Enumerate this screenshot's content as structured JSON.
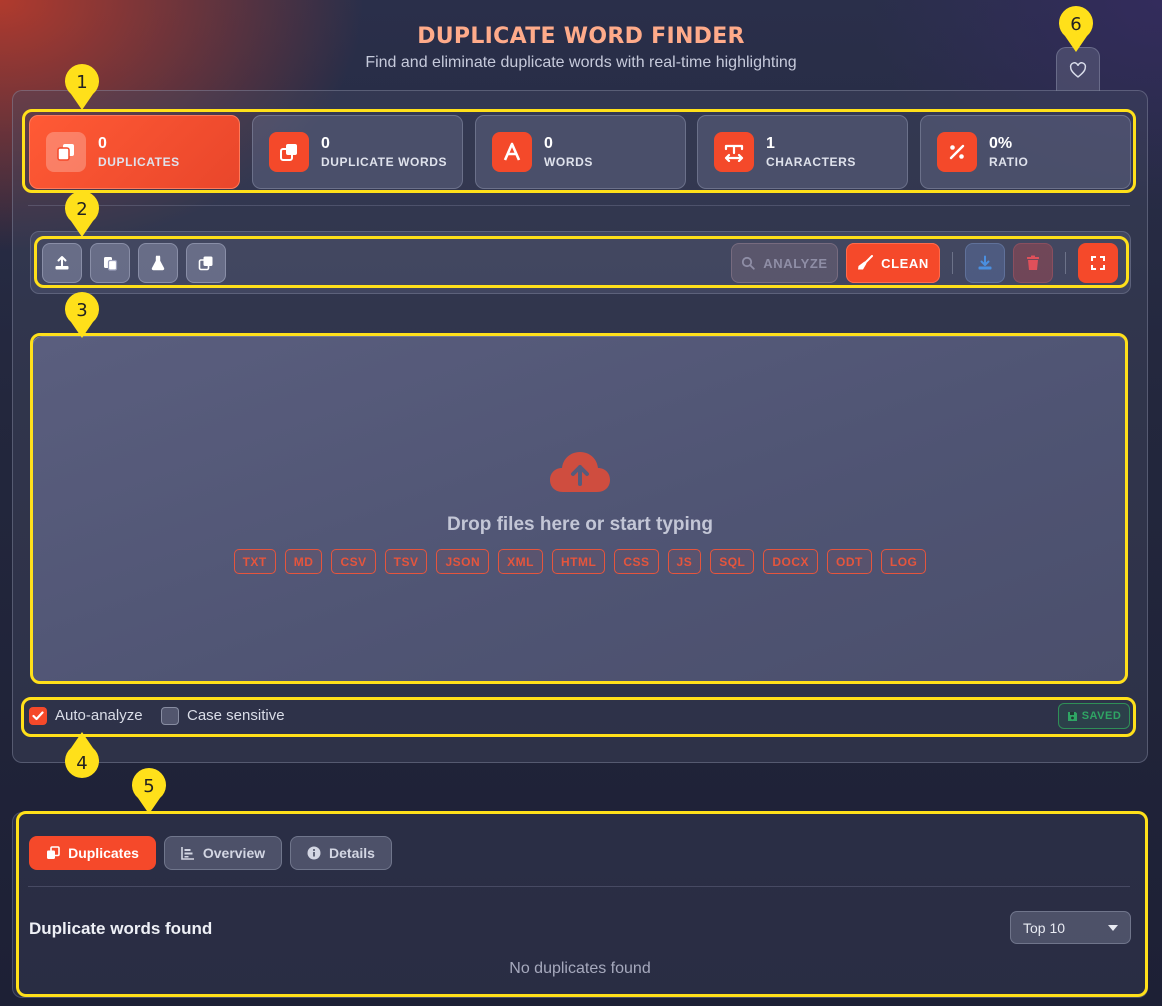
{
  "header": {
    "title": "DUPLICATE WORD FINDER",
    "subtitle": "Find and eliminate duplicate words with real-time highlighting"
  },
  "stats": [
    {
      "value": "0",
      "label": "DUPLICATES",
      "icon": "copy-icon"
    },
    {
      "value": "0",
      "label": "DUPLICATE WORDS",
      "icon": "clone-icon"
    },
    {
      "value": "0",
      "label": "WORDS",
      "icon": "font-icon"
    },
    {
      "value": "1",
      "label": "CHARACTERS",
      "icon": "text-width-icon"
    },
    {
      "value": "0%",
      "label": "RATIO",
      "icon": "percent-icon"
    }
  ],
  "toolbar": {
    "analyze_label": "ANALYZE",
    "clean_label": "CLEAN"
  },
  "dropzone": {
    "prompt": "Drop files here or start typing",
    "formats": [
      "TXT",
      "MD",
      "CSV",
      "TSV",
      "JSON",
      "XML",
      "HTML",
      "CSS",
      "JS",
      "SQL",
      "DOCX",
      "ODT",
      "LOG"
    ]
  },
  "options": {
    "auto_analyze_label": "Auto-analyze",
    "auto_analyze_checked": true,
    "case_sensitive_label": "Case sensitive",
    "case_sensitive_checked": false,
    "saved_label": "SAVED"
  },
  "results": {
    "tabs": [
      {
        "label": "Duplicates",
        "active": true
      },
      {
        "label": "Overview",
        "active": false
      },
      {
        "label": "Details",
        "active": false
      }
    ],
    "heading": "Duplicate words found",
    "top_select_value": "Top 10",
    "empty_message": "No duplicates found"
  },
  "annotations": [
    "1",
    "2",
    "3",
    "4",
    "5",
    "6"
  ],
  "colors": {
    "accent": "#f5492a",
    "title": "#ffab8a",
    "annotation": "#ffe01a",
    "saved": "#2fa564"
  }
}
